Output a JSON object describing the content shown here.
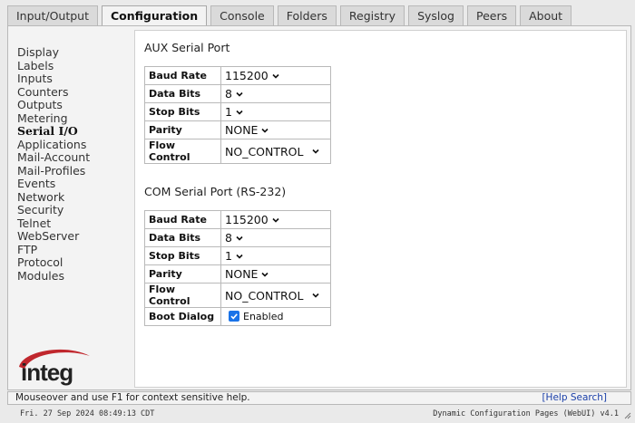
{
  "tabs": [
    {
      "label": "Input/Output",
      "active": false
    },
    {
      "label": "Configuration",
      "active": true
    },
    {
      "label": "Console",
      "active": false
    },
    {
      "label": "Folders",
      "active": false
    },
    {
      "label": "Registry",
      "active": false
    },
    {
      "label": "Syslog",
      "active": false
    },
    {
      "label": "Peers",
      "active": false
    },
    {
      "label": "About",
      "active": false
    }
  ],
  "sidebar": {
    "items": [
      {
        "label": "Display"
      },
      {
        "label": "Labels"
      },
      {
        "label": "Inputs"
      },
      {
        "label": "Counters"
      },
      {
        "label": "Outputs"
      },
      {
        "label": "Metering"
      },
      {
        "label": "Serial I/O",
        "active": true
      },
      {
        "label": "Applications"
      },
      {
        "label": "Mail-Account"
      },
      {
        "label": "Mail-Profiles"
      },
      {
        "label": "Events"
      },
      {
        "label": "Network"
      },
      {
        "label": "Security"
      },
      {
        "label": "Telnet"
      },
      {
        "label": "WebServer"
      },
      {
        "label": "FTP"
      },
      {
        "label": "Protocol"
      },
      {
        "label": "Modules"
      }
    ],
    "logo_text": "integ"
  },
  "aux": {
    "title": "AUX Serial Port",
    "baud_label": "Baud Rate",
    "baud_value": "115200",
    "data_label": "Data Bits",
    "data_value": "8",
    "stop_label": "Stop Bits",
    "stop_value": "1",
    "parity_label": "Parity",
    "parity_value": "NONE",
    "flow_label": "Flow Control",
    "flow_value": "NO_CONTROL"
  },
  "com": {
    "title": "COM Serial Port (RS-232)",
    "baud_label": "Baud Rate",
    "baud_value": "115200",
    "data_label": "Data Bits",
    "data_value": "8",
    "stop_label": "Stop Bits",
    "stop_value": "1",
    "parity_label": "Parity",
    "parity_value": "NONE",
    "flow_label": "Flow Control",
    "flow_value": "NO_CONTROL",
    "boot_label": "Boot Dialog",
    "boot_value": "Enabled",
    "boot_checked": true
  },
  "statusbar": {
    "hint": "Mouseover and use F1 for context sensitive help.",
    "help_link": "[Help Search]"
  },
  "footer": {
    "datetime": "Fri. 27 Sep 2024 08:49:13 CDT",
    "version": "Dynamic Configuration Pages (WebUI) v4.1"
  },
  "colors": {
    "accent": "#1a73e8",
    "logo_red": "#c0272d",
    "link": "#1a3fa8"
  }
}
